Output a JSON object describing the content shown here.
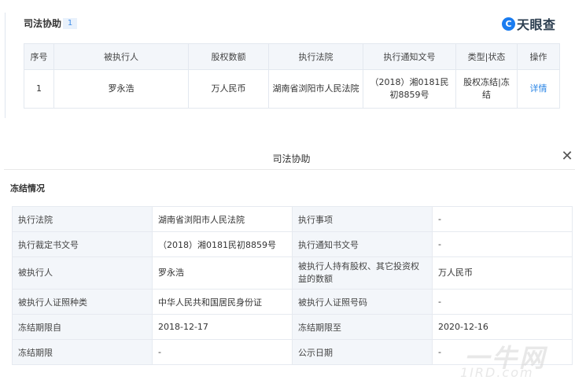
{
  "header": {
    "section_title": "司法协助",
    "count_badge": "1",
    "logo_text": "天眼查",
    "logo_mark": "C"
  },
  "list_table": {
    "columns": [
      "序号",
      "被执行人",
      "股权数额",
      "执行法院",
      "执行通知文号",
      "类型|状态",
      "操作"
    ],
    "rows": [
      {
        "index": "1",
        "executee": "罗永浩",
        "equity_amount": "万人民币",
        "court": "湖南省浏阳市人民法院",
        "notice_no": "（2018）湘0181民初8859号",
        "type_status": "股权冻结|冻结",
        "action": "详情"
      }
    ]
  },
  "dialog": {
    "title": "司法协助",
    "close_icon": "close-icon",
    "section": "冻结情况",
    "rows": [
      {
        "k1": "执行法院",
        "v1": "湖南省浏阳市人民法院",
        "k2": "执行事项",
        "v2": "-"
      },
      {
        "k1": "执行裁定书文号",
        "v1": "（2018）湘0181民初8859号",
        "k2": "执行通知书文号",
        "v2": "-"
      },
      {
        "k1": "被执行人",
        "v1": "罗永浩",
        "k2": "被执行人持有股权、其它投资权益的数额",
        "v2": "万人民币"
      },
      {
        "k1": "被执行人证照种类",
        "v1": "中华人民共和国居民身份证",
        "k2": "被执行人证照号码",
        "v2": "-"
      },
      {
        "k1": "冻结期限自",
        "v1": "2018-12-17",
        "k2": "冻结期限至",
        "v2": "2020-12-16"
      },
      {
        "k1": "冻结期限",
        "v1": "-",
        "k2": "公示日期",
        "v2": "-"
      }
    ]
  },
  "watermark": {
    "main": "一牛网",
    "sub": "1IRD.com"
  }
}
